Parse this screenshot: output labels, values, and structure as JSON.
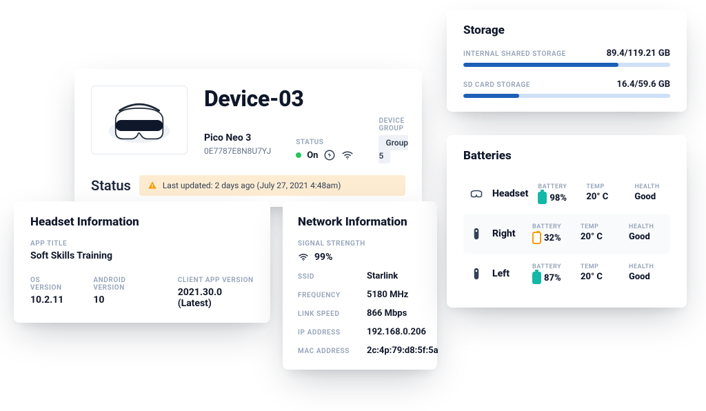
{
  "device": {
    "name": "Device-03",
    "model": "Pico Neo 3",
    "serial": "0E7787E8N8U7YJ",
    "status_label": "STATUS",
    "status_value": "On",
    "device_group_label": "DEVICE GROUP",
    "device_group_value": "Group 5"
  },
  "status_banner": {
    "title": "Status",
    "text": "Last updated: 2 days ago (July 27, 2021 4:48am)"
  },
  "headset_info": {
    "title": "Headset Information",
    "app_title_label": "APP TITLE",
    "app_title": "Soft Skills Training",
    "os_version_label": "OS VERSION",
    "os_version": "10.2.11",
    "android_version_label": "ANDROID VERSION",
    "android_version": "10",
    "client_app_version_label": "CLIENT APP VERSION",
    "client_app_version": "2021.30.0 (Latest)"
  },
  "network": {
    "title": "Network Information",
    "signal_label": "SIGNAL STRENGTH",
    "signal_value": "99%",
    "ssid_label": "SSID",
    "ssid": "Starlink",
    "frequency_label": "FREQUENCY",
    "frequency": "5180 MHz",
    "link_speed_label": "LINK SPEED",
    "link_speed": "866 Mbps",
    "ip_label": "IP ADDRESS",
    "ip": "192.168.0.206",
    "mac_label": "MAC ADDRESS",
    "mac": "2c:4p:79:d8:5f:5a"
  },
  "storage": {
    "title": "Storage",
    "internal_label": "INTERNAL SHARED STORAGE",
    "internal_value": "89.4/119.21 GB",
    "internal_percent": 75,
    "sd_label": "SD CARD STORAGE",
    "sd_value": "16.4/59.6 GB",
    "sd_percent": 27
  },
  "batteries": {
    "title": "Batteries",
    "labels": {
      "battery": "BATTERY",
      "temp": "TEMP",
      "health": "HEALTH"
    },
    "rows": [
      {
        "name": "Headset",
        "battery": "98%",
        "temp": "20° C",
        "health": "Good",
        "level": "high",
        "icon": "headset"
      },
      {
        "name": "Right",
        "battery": "32%",
        "temp": "20° C",
        "health": "Good",
        "level": "low",
        "icon": "controller"
      },
      {
        "name": "Left",
        "battery": "87%",
        "temp": "20° C",
        "health": "Good",
        "level": "high",
        "icon": "controller"
      }
    ]
  }
}
